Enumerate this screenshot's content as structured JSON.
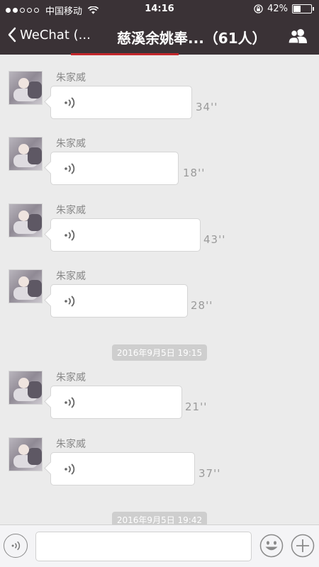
{
  "status_bar": {
    "signal_bars_filled": 2,
    "signal_bars_total": 5,
    "carrier": "中国移动",
    "time": "14:16",
    "battery_text": "42%",
    "battery_level": 0.42,
    "icons": [
      "wifi-icon",
      "orientation-lock-icon",
      "battery-icon"
    ]
  },
  "nav": {
    "back_label": "WeChat (...",
    "title": "慈溪余姚奉...（61人）",
    "members_icon": "members-icon"
  },
  "messages": [
    {
      "sender": "朱家威",
      "duration": "34''",
      "width_level": 34
    },
    {
      "sender": "朱家威",
      "duration": "18''",
      "width_level": 18
    },
    {
      "sender": "朱家威",
      "duration": "43''",
      "width_level": 43
    },
    {
      "sender": "朱家威",
      "duration": "28''",
      "width_level": 28
    }
  ],
  "timestamp_1": "2016年9月5日 19:15",
  "messages_2": [
    {
      "sender": "朱家威",
      "duration": "21''",
      "width_level": 21
    },
    {
      "sender": "朱家威",
      "duration": "37''",
      "width_level": 37
    }
  ],
  "timestamp_2": "2016年9月5日 19:42",
  "input_bar": {
    "icons": [
      "voice-toggle-icon",
      "emoji-icon",
      "plus-icon"
    ],
    "text_value": ""
  }
}
